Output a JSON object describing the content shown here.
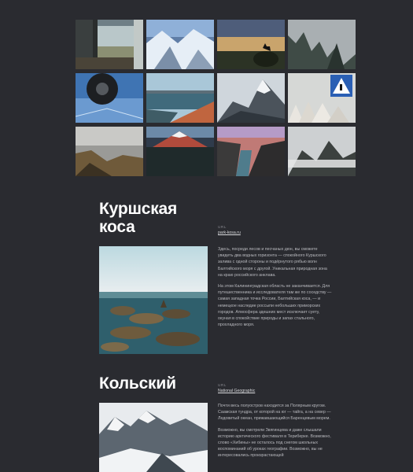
{
  "gallery": {
    "tiles": [
      {
        "icon": "train-window-photo"
      },
      {
        "icon": "snowy-mountains-aerial-photo"
      },
      {
        "icon": "wolf-silhouette-sunset-photo"
      },
      {
        "icon": "misty-forest-photo"
      },
      {
        "icon": "wheel-on-ice-photo"
      },
      {
        "icon": "red-shore-sea-photo"
      },
      {
        "icon": "snowy-peak-photo"
      },
      {
        "icon": "pedestrian-sign-photo"
      },
      {
        "icon": "valley-fog-photo"
      },
      {
        "icon": "volcano-photo"
      },
      {
        "icon": "canyon-river-photo"
      },
      {
        "icon": "cloudy-mountains-photo"
      }
    ]
  },
  "sections": [
    {
      "title_line1": "Куршская",
      "title_line2": "коса",
      "url_label": "URL",
      "url_text": "park-kosa.ru",
      "paragraphs": [
        "Здесь, посреди лесов и песчаных дюн, вы сможете увидеть два водных горизонта — спокойного Куршского залива с одной стороны и подёрнутого рябью волн Балтийского моря с другой. Уникальная природная зона на краю российского анклава.",
        "На этом Калининградская область не заканчивается. Для путешественника и исследователя там же по соседству — самая западная точка России, Балтийская коса, — и немецкое наследие россыпи небольших приморских городов. Атмосфера здешних мест исключает суету, окуная в спокойствие природы и запах стального, прохладного моря."
      ]
    },
    {
      "title_line1": "Кольский",
      "url_label": "URL",
      "url_text": "National Geographic",
      "paragraphs": [
        "Почти весь полуостров находится за Полярным кругом. Саамская тундра, от которой на юг — тайга, а на север — Ледовитый океан, прижавшающийся Баренцевым морем.",
        "Возможно, вы смотрели Звягинцева и даже слышали историю арктического фестиваля в Териберке. Возможно, слово «Хибины» не осталось под снегом школьных воспоминаний об уроках географии. Возможно, вы не интересовались произрастающей"
      ]
    }
  ]
}
